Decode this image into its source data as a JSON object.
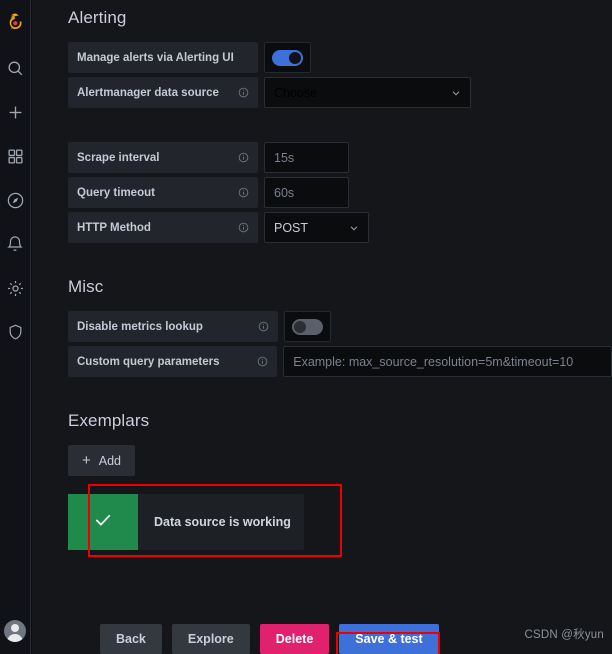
{
  "sidebar": {
    "items": [
      {
        "name": "grafana-logo",
        "icon": "grafana-logo-icon"
      },
      {
        "name": "search",
        "icon": "search-icon"
      },
      {
        "name": "create",
        "icon": "plus-icon"
      },
      {
        "name": "dashboards",
        "icon": "grid-icon"
      },
      {
        "name": "explore",
        "icon": "compass-icon"
      },
      {
        "name": "alerting",
        "icon": "bell-icon"
      },
      {
        "name": "configuration",
        "icon": "gear-icon"
      },
      {
        "name": "server-admin",
        "icon": "shield-icon"
      }
    ],
    "avatar_label": "user-avatar"
  },
  "alerting": {
    "title": "Alerting",
    "manage_alerts": {
      "label": "Manage alerts via Alerting UI",
      "toggle_state": "on"
    },
    "alertmanager": {
      "label": "Alertmanager data source",
      "placeholder": "Choose",
      "value": ""
    }
  },
  "query_settings": {
    "scrape_interval": {
      "label": "Scrape interval",
      "placeholder": "15s",
      "value": ""
    },
    "query_timeout": {
      "label": "Query timeout",
      "placeholder": "60s",
      "value": ""
    },
    "http_method": {
      "label": "HTTP Method",
      "value": "POST"
    }
  },
  "misc": {
    "title": "Misc",
    "disable_metrics_lookup": {
      "label": "Disable metrics lookup",
      "toggle_state": "off"
    },
    "custom_query_parameters": {
      "label": "Custom query parameters",
      "placeholder": "Example: max_source_resolution=5m&timeout=10",
      "value": ""
    }
  },
  "exemplars": {
    "title": "Exemplars",
    "add_label": "Add",
    "add_icon": "plus-icon"
  },
  "test_result": {
    "message": "Data source is working",
    "icon": "check-icon",
    "status_color": "#1f8a4c"
  },
  "footer_buttons": {
    "back": "Back",
    "explore": "Explore",
    "delete": "Delete",
    "save_and_test": "Save & test"
  },
  "colors": {
    "accent_blue": "#3d71d9",
    "danger_pink": "#e0226e",
    "success_green": "#1f8a4c",
    "annotation_red": "#ef0000",
    "page_bg": "#141619",
    "sidebar_bg": "#111217"
  },
  "watermark": {
    "text": "CSDN @秋yun"
  }
}
